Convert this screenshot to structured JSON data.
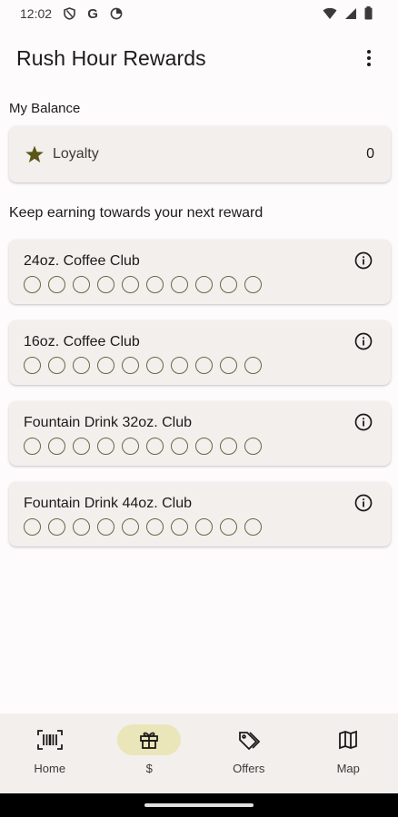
{
  "status_bar": {
    "time": "12:02",
    "left_icons": [
      "vpn-shield-icon",
      "google-icon",
      "data-saver-icon"
    ],
    "right_icons": [
      "wifi-icon",
      "signal-icon",
      "battery-icon"
    ]
  },
  "app_bar": {
    "title": "Rush Hour Rewards",
    "menu_icon": "more-vert-icon"
  },
  "balance": {
    "heading": "My Balance",
    "items": [
      {
        "icon": "star-icon",
        "name": "Loyalty",
        "value": "0"
      }
    ]
  },
  "rewards": {
    "heading": "Keep earning towards your next reward",
    "clubs": [
      {
        "title": "24oz. Coffee Club",
        "punches": 10,
        "filled": 0
      },
      {
        "title": "16oz. Coffee Club",
        "punches": 10,
        "filled": 0
      },
      {
        "title": "Fountain Drink 32oz. Club",
        "punches": 10,
        "filled": 0
      },
      {
        "title": "Fountain Drink 44oz. Club",
        "punches": 10,
        "filled": 0
      }
    ]
  },
  "bottom_nav": {
    "items": [
      {
        "label": "Home",
        "icon": "barcode-scan-icon",
        "active": false
      },
      {
        "label": "$",
        "icon": "gift-icon",
        "active": true
      },
      {
        "label": "Offers",
        "icon": "tag-icon",
        "active": false
      },
      {
        "label": "Map",
        "icon": "map-icon",
        "active": false
      }
    ]
  },
  "colors": {
    "background": "#fdfbfc",
    "card": "#f3efec",
    "accent_pill": "#ebe6ba",
    "star": "#5a5618"
  }
}
